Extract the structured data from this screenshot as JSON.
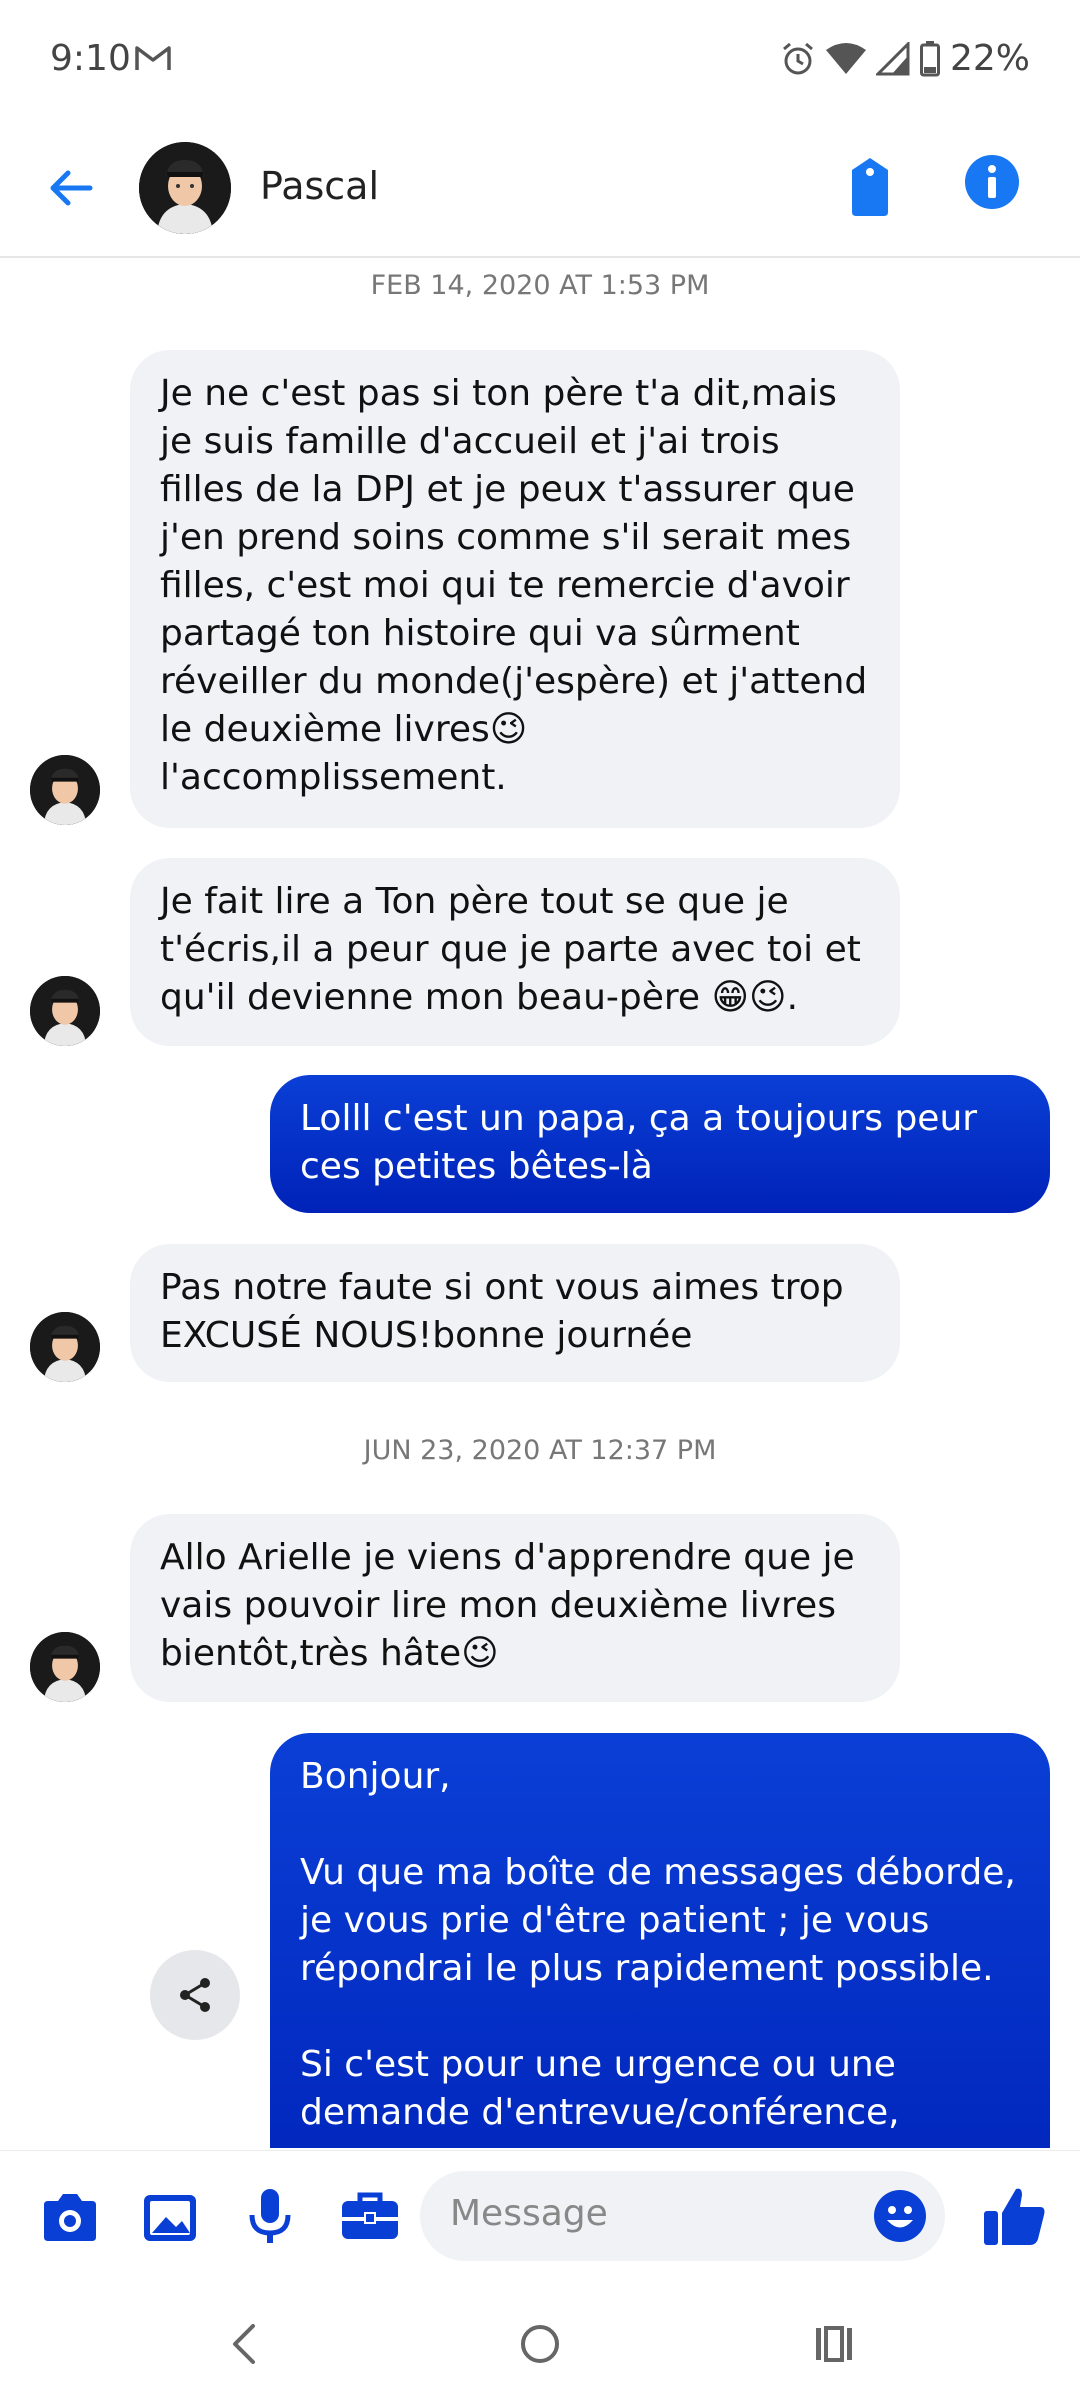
{
  "status_bar": {
    "time": "9:10",
    "battery": "22%"
  },
  "header": {
    "contact_name": "Pascal"
  },
  "messages": [
    {
      "type": "timestamp",
      "text": "FEB 14, 2020 AT 1:53 PM"
    },
    {
      "type": "incoming",
      "text": "Je ne c'est pas si ton père t'a dit,mais je suis famille d'accueil et j'ai trois filles de la DPJ et je peux t'assurer que j'en prend soins comme s'il serait mes filles, c'est moi qui te remercie d'avoir partagé ton histoire qui va sûrment réveiller du monde(j'espère) et j'attend le deuxième livres😉 l'accomplissement."
    },
    {
      "type": "incoming",
      "text": "Je fait lire a Ton père tout se que je t'écris,il a peur que je parte avec toi et qu'il devienne mon beau-père 😁😉."
    },
    {
      "type": "outgoing",
      "text": "Lolll c'est un papa, ça a toujours peur ces petites bêtes-là"
    },
    {
      "type": "incoming",
      "text": "Pas notre faute si ont vous aimes trop EXCUSÉ NOUS!bonne journée"
    },
    {
      "type": "timestamp",
      "text": "JUN 23, 2020 AT 12:37 PM"
    },
    {
      "type": "incoming",
      "text": "Allo Arielle je viens d'apprendre que je vais pouvoir lire mon deuxième livres bientôt,très hâte😉"
    },
    {
      "type": "outgoing",
      "text": "Bonjour,\n\nVu que ma boîte de messages déborde, je vous prie d'être patient ; je vous répondrai le plus rapidement possible.\n\nSi c'est pour une urgence ou une demande d'entrevue/conférence,"
    }
  ],
  "composer": {
    "placeholder": "Message"
  },
  "colors": {
    "accent": "#1877f2",
    "outgoing_top": "#0a3fd6",
    "outgoing_bottom": "#0022b8",
    "incoming_bg": "#f1f2f6",
    "composer_icons": "#0a3fd6"
  },
  "icons": {
    "status": [
      "gmail-icon",
      "alarm-icon",
      "wifi-icon",
      "signal-icon",
      "battery-icon"
    ],
    "header": [
      "back-arrow-icon",
      "tag-icon",
      "info-icon"
    ],
    "composer": [
      "camera-icon",
      "gallery-icon",
      "microphone-icon",
      "briefcase-icon",
      "emoji-icon",
      "thumbs-up-icon"
    ],
    "nav": [
      "back-nav-icon",
      "home-nav-icon",
      "recents-nav-icon"
    ]
  }
}
